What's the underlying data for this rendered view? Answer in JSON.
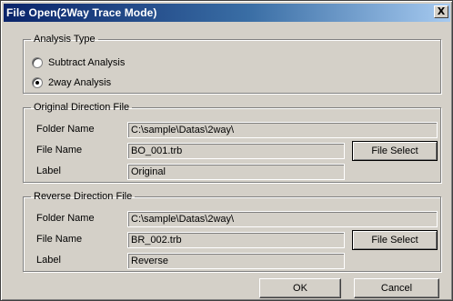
{
  "window": {
    "title": "File Open(2Way Trace Mode)",
    "close_symbol": "X"
  },
  "analysis_type": {
    "legend": "Analysis Type",
    "options": [
      {
        "label": "Subtract Analysis",
        "selected": false
      },
      {
        "label": "2way  Analysis",
        "selected": true
      }
    ]
  },
  "original": {
    "legend": "Original Direction File",
    "folder_label": "Folder Name",
    "folder_value": "C:\\sample\\Datas\\2way\\",
    "file_label": "File Name",
    "file_value": "BO_001.trb",
    "label_label": "Label",
    "label_value": "Original",
    "select_button": "File Select"
  },
  "reverse": {
    "legend": "Reverse Direction File",
    "folder_label": "Folder Name",
    "folder_value": "C:\\sample\\Datas\\2way\\",
    "file_label": "File Name",
    "file_value": "BR_002.trb",
    "label_label": "Label",
    "label_value": "Reverse",
    "select_button": "File Select"
  },
  "footer": {
    "ok_label": "OK",
    "cancel_label": "Cancel"
  },
  "colors": {
    "title_bar_start": "#0a246a",
    "title_bar_end": "#a6caf0",
    "dialog_face": "#d4d0c8"
  }
}
